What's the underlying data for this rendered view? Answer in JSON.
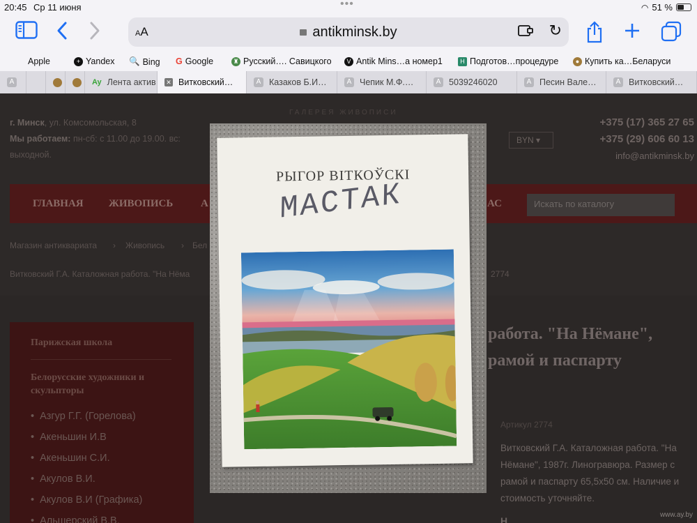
{
  "status": {
    "time": "20:45",
    "date": "Ср 11 июня",
    "battery": "51 %"
  },
  "browser": {
    "aa_label": "AA",
    "url": "antikminsk.by",
    "favorites": [
      "Apple",
      "Yandex",
      "Bing",
      "Google",
      "Русский…. Савицкого",
      "Antik Mins…а номер1",
      "Подготов…процедуре",
      "Купить ка…Беларуси"
    ],
    "tabs": [
      "Лента актив…",
      "Витковский…",
      "Казаков Б.И…",
      "Чепик М.Ф.…",
      "5039246020",
      "Песин Вале…",
      "Витковский…"
    ]
  },
  "site": {
    "gallery": "ГАЛЕРЕЯ ЖИВОПИСИ",
    "city": "г. Минск",
    "address": ", ул. Комсомольская, 8",
    "hours_label": "Мы работаем:",
    "hours": " пн-сб: с 11.00 до 19.00. вс:",
    "dayoff": "выходной.",
    "currency": "BYN",
    "phone1": "+375 (17) 365 27 65",
    "phone2": "+375 (29) 606 60 13",
    "email": "info@antikminsk.by",
    "nav": [
      "ГЛАВНАЯ",
      "ЖИВОПИСЬ",
      "А",
      "АС"
    ],
    "search_placeholder": "Искать по каталогу",
    "breadcrumbs": [
      "Магазин антиквариата",
      "Живопись",
      "Бел"
    ],
    "page_line": "Витковский Г.А. Каталожная работа. \"На Нёма",
    "page_line_end": "2774"
  },
  "sidebar": {
    "heading1": "Парижская школа",
    "heading2": "Белорусские художники и скульпторы",
    "items": [
      "Азгур Г.Г. (Горелова)",
      "Акеньшин И.В",
      "Акеньшин С.И.",
      "Акулов В.И.",
      "Акулов В.И (Графика)",
      "Альшерский В.В."
    ]
  },
  "product": {
    "title_line1": "работа. \"На Нёмане\",",
    "title_line2": "рамой и паспарту",
    "article": "Артикул 2774",
    "description": "Витковский Г.А. Каталожная работа. \"На Нёмане\", 1987г. Линогравюра. Размер с рамой и паспарту 65,5х50 см. Наличие и стоимость уточняйте.",
    "more": "Н"
  },
  "overlay": {
    "author": "РЫГОР ВІТКОЎСКІ",
    "handwriting": "МАСТАК",
    "watermark": "www.ay.by"
  },
  "colors": {
    "accent": "#1f6ff3",
    "nav_bar": "#4c1818",
    "sidebar": "#3c1414"
  }
}
